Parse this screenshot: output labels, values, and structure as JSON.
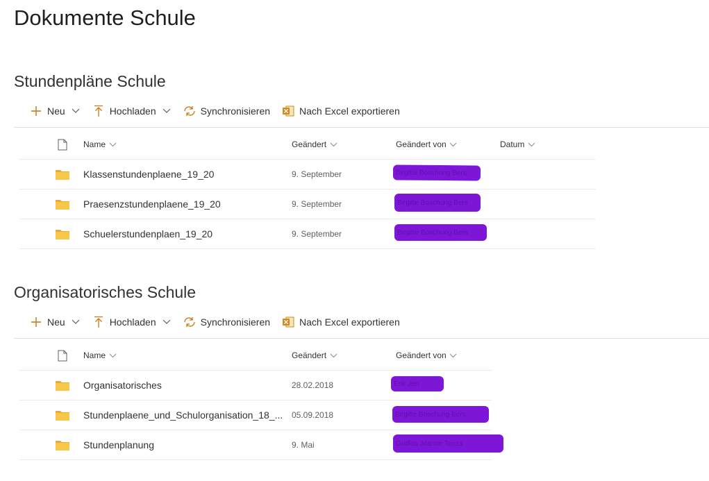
{
  "page": {
    "title": "Dokumente Schule"
  },
  "toolbar": {
    "new_label": "Neu",
    "upload_label": "Hochladen",
    "sync_label": "Synchronisieren",
    "export_label": "Nach Excel exportieren"
  },
  "colors": {
    "accent": "#c8780a",
    "folder": "#f8c74a",
    "redaction": "#7a0fd6"
  },
  "sections": [
    {
      "title": "Stundenpläne Schule",
      "columns": {
        "name": "Name",
        "modified": "Geändert",
        "modified_by": "Geändert von",
        "date": "Datum"
      },
      "rows": [
        {
          "name": "Klassenstundenplaene_19_20",
          "modified": "9. September",
          "modified_by_redacted": "Birgitte Boschung Bers"
        },
        {
          "name": "Praesenzstundenplaene_19_20",
          "modified": "9. September",
          "modified_by_redacted": "Birgitte Boschung Bers"
        },
        {
          "name": "Schuelerstundenplaen_19_20",
          "modified": "9. September",
          "modified_by_redacted": "Birgitte Boschung Bers"
        }
      ]
    },
    {
      "title": "Organisatorisches Schule",
      "columns": {
        "name": "Name",
        "modified": "Geändert",
        "modified_by": "Geändert von"
      },
      "rows": [
        {
          "name": "Organisatorisches",
          "modified": "28.02.2018",
          "modified_by_redacted": "Erik Jen"
        },
        {
          "name": "Stundenplaene_und_Schulorganisation_18_...",
          "modified": "05.09.2018",
          "modified_by_redacted": "Birgitte Boschung Bers"
        },
        {
          "name": "Stundenplanung",
          "modified": "9. Mai",
          "modified_by_redacted": "Gudlos Jeanne Teuza"
        }
      ]
    }
  ]
}
